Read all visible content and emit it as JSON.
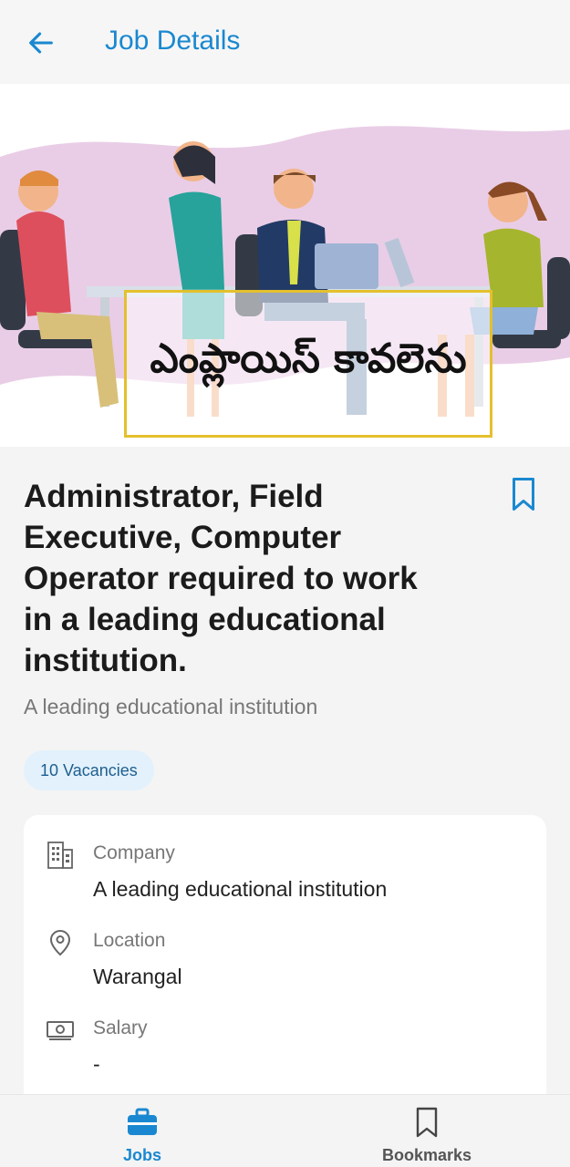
{
  "header": {
    "title": "Job Details",
    "back_icon": "arrow-left-icon"
  },
  "banner": {
    "caption": "ఎంప్లాయిస్ కావలెను"
  },
  "job": {
    "title": "Administrator, Field Executive, Computer Operator required to work in a leading educational institution.",
    "company": "A leading educational institution",
    "vacancies": "10 Vacancies"
  },
  "details": {
    "company_label": "Company",
    "company_value": "A leading educational institution",
    "location_label": "Location",
    "location_value": "Warangal",
    "salary_label": "Salary",
    "salary_value": "-"
  },
  "nav": {
    "jobs": "Jobs",
    "bookmarks": "Bookmarks"
  },
  "colors": {
    "accent": "#1a88d0",
    "badge_bg": "#e2f1fc",
    "text": "#1b1b1b",
    "muted": "#777777"
  }
}
